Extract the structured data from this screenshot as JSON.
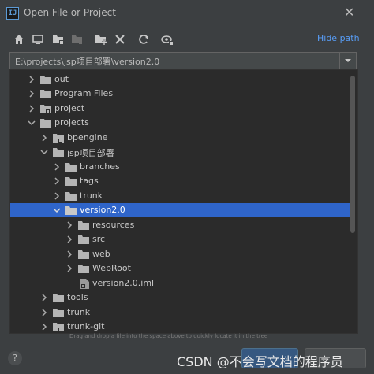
{
  "window": {
    "title": "Open File or Project",
    "app_icon": "intellij-icon"
  },
  "toolbar": {
    "icons": [
      "home-icon",
      "desktop-icon",
      "project-folder-icon",
      "module-folder-icon",
      "new-folder-icon",
      "delete-icon",
      "refresh-icon",
      "show-hidden-icon"
    ],
    "hide_path_label": "Hide path"
  },
  "path": {
    "value": "E:\\projects\\jsp项目部署\\version2.0"
  },
  "tree": {
    "items": [
      {
        "label": "out"
      },
      {
        "label": "Program Files"
      },
      {
        "label": "project"
      },
      {
        "label": "projects"
      },
      {
        "label": "bpengine"
      },
      {
        "label": "jsp项目部署"
      },
      {
        "label": "branches"
      },
      {
        "label": "tags"
      },
      {
        "label": "trunk"
      },
      {
        "label": "version2.0"
      },
      {
        "label": "resources"
      },
      {
        "label": "src"
      },
      {
        "label": "web"
      },
      {
        "label": "WebRoot"
      },
      {
        "label": "version2.0.iml"
      },
      {
        "label": "tools"
      },
      {
        "label": "trunk"
      },
      {
        "label": "trunk-git"
      }
    ]
  },
  "hint": "Drag and drop a file into the space above to quickly locate it in the tree",
  "watermark": "CSDN @不会写文档的程序员",
  "colors": {
    "accent": "#589df6",
    "selection": "#2f65ca",
    "background": "#3c3f41",
    "tree_background": "#2b2b2b"
  }
}
